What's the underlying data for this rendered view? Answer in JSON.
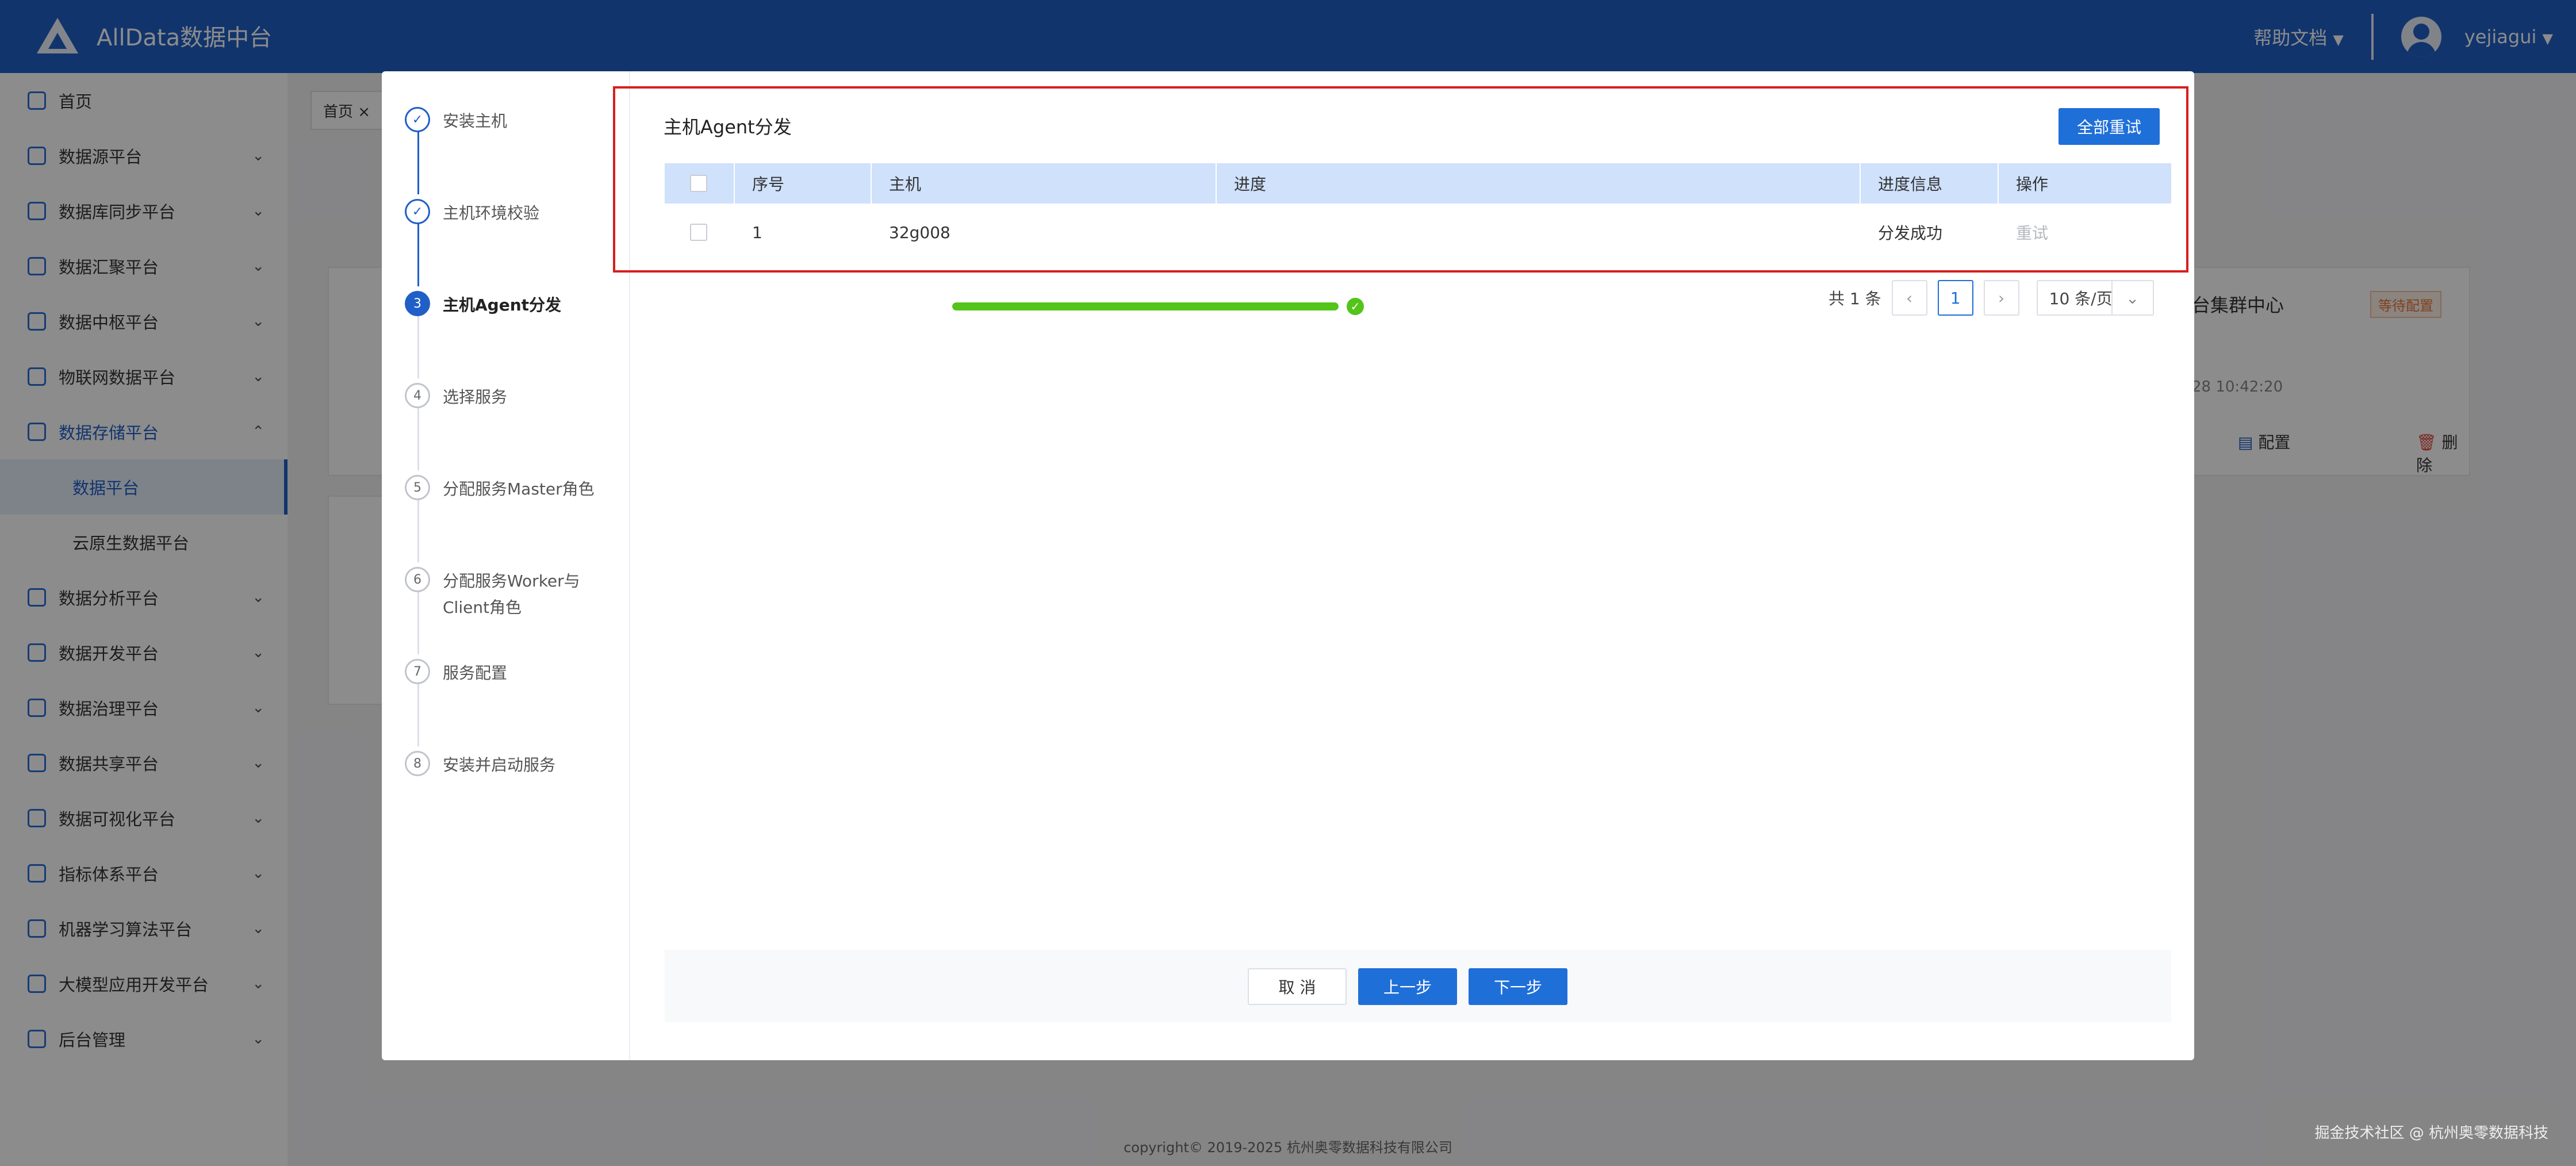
{
  "header": {
    "brand": "AllData数据中台",
    "help": "帮助文档",
    "help_arrow": "▼",
    "username": "yejiagui",
    "user_arrow": "▼"
  },
  "sidebar": {
    "items": [
      {
        "label": "首页",
        "chevron": ""
      },
      {
        "label": "数据源平台",
        "chevron": "⌄"
      },
      {
        "label": "数据库同步平台",
        "chevron": "⌄"
      },
      {
        "label": "数据汇聚平台",
        "chevron": "⌄"
      },
      {
        "label": "数据中枢平台",
        "chevron": "⌄"
      },
      {
        "label": "物联网数据平台",
        "chevron": "⌄"
      },
      {
        "label": "数据存储平台",
        "chevron": "⌃"
      },
      {
        "label": "数据分析平台",
        "chevron": "⌄"
      },
      {
        "label": "数据开发平台",
        "chevron": "⌄"
      },
      {
        "label": "数据治理平台",
        "chevron": "⌄"
      },
      {
        "label": "数据共享平台",
        "chevron": "⌄"
      },
      {
        "label": "数据可视化平台",
        "chevron": "⌄"
      },
      {
        "label": "指标体系平台",
        "chevron": "⌄"
      },
      {
        "label": "机器学习算法平台",
        "chevron": "⌄"
      },
      {
        "label": "大模型应用开发平台",
        "chevron": "⌄"
      },
      {
        "label": "后台管理",
        "chevron": "⌄"
      }
    ],
    "subitems": [
      {
        "label": "数据平台"
      },
      {
        "label": "云原生数据平台"
      }
    ]
  },
  "background": {
    "breadcrumb": "首页 ×",
    "card_title_fragment": "台集群中心",
    "card_badge": "等待配置",
    "card_time": "28 10:42:20",
    "config_label": "配置",
    "delete_label": "删除"
  },
  "wizard": {
    "steps": [
      {
        "index": "✓",
        "label": "安装主机"
      },
      {
        "index": "✓",
        "label": "主机环境校验"
      },
      {
        "index": "3",
        "label": "主机Agent分发"
      },
      {
        "index": "4",
        "label": "选择服务"
      },
      {
        "index": "5",
        "label": "分配服务Master角色"
      },
      {
        "index": "6",
        "label": "分配服务Worker与Client角色"
      },
      {
        "index": "7",
        "label": "服务配置"
      },
      {
        "index": "8",
        "label": "安装并启动服务"
      }
    ],
    "panel_title": "主机Agent分发",
    "retry_all": "全部重试",
    "table": {
      "columns": [
        "序号",
        "主机",
        "进度",
        "进度信息",
        "操作"
      ],
      "rows": [
        {
          "index": "1",
          "host": "32g008",
          "progress": 100,
          "status": "分发成功",
          "action": "重试"
        }
      ]
    },
    "pager": {
      "total": "共 1 条",
      "prev": "‹",
      "page": "1",
      "next": "›",
      "page_size": "10 条/页",
      "size_arrow": "⌄"
    },
    "buttons": {
      "cancel": "取 消",
      "prev": "上一步",
      "next": "下一步"
    }
  },
  "footer": {
    "copyright": "copyright© 2019-2025 杭州奥零数据科技有限公司",
    "watermark": "掘金技术社区 @ 杭州奥零数据科技"
  }
}
